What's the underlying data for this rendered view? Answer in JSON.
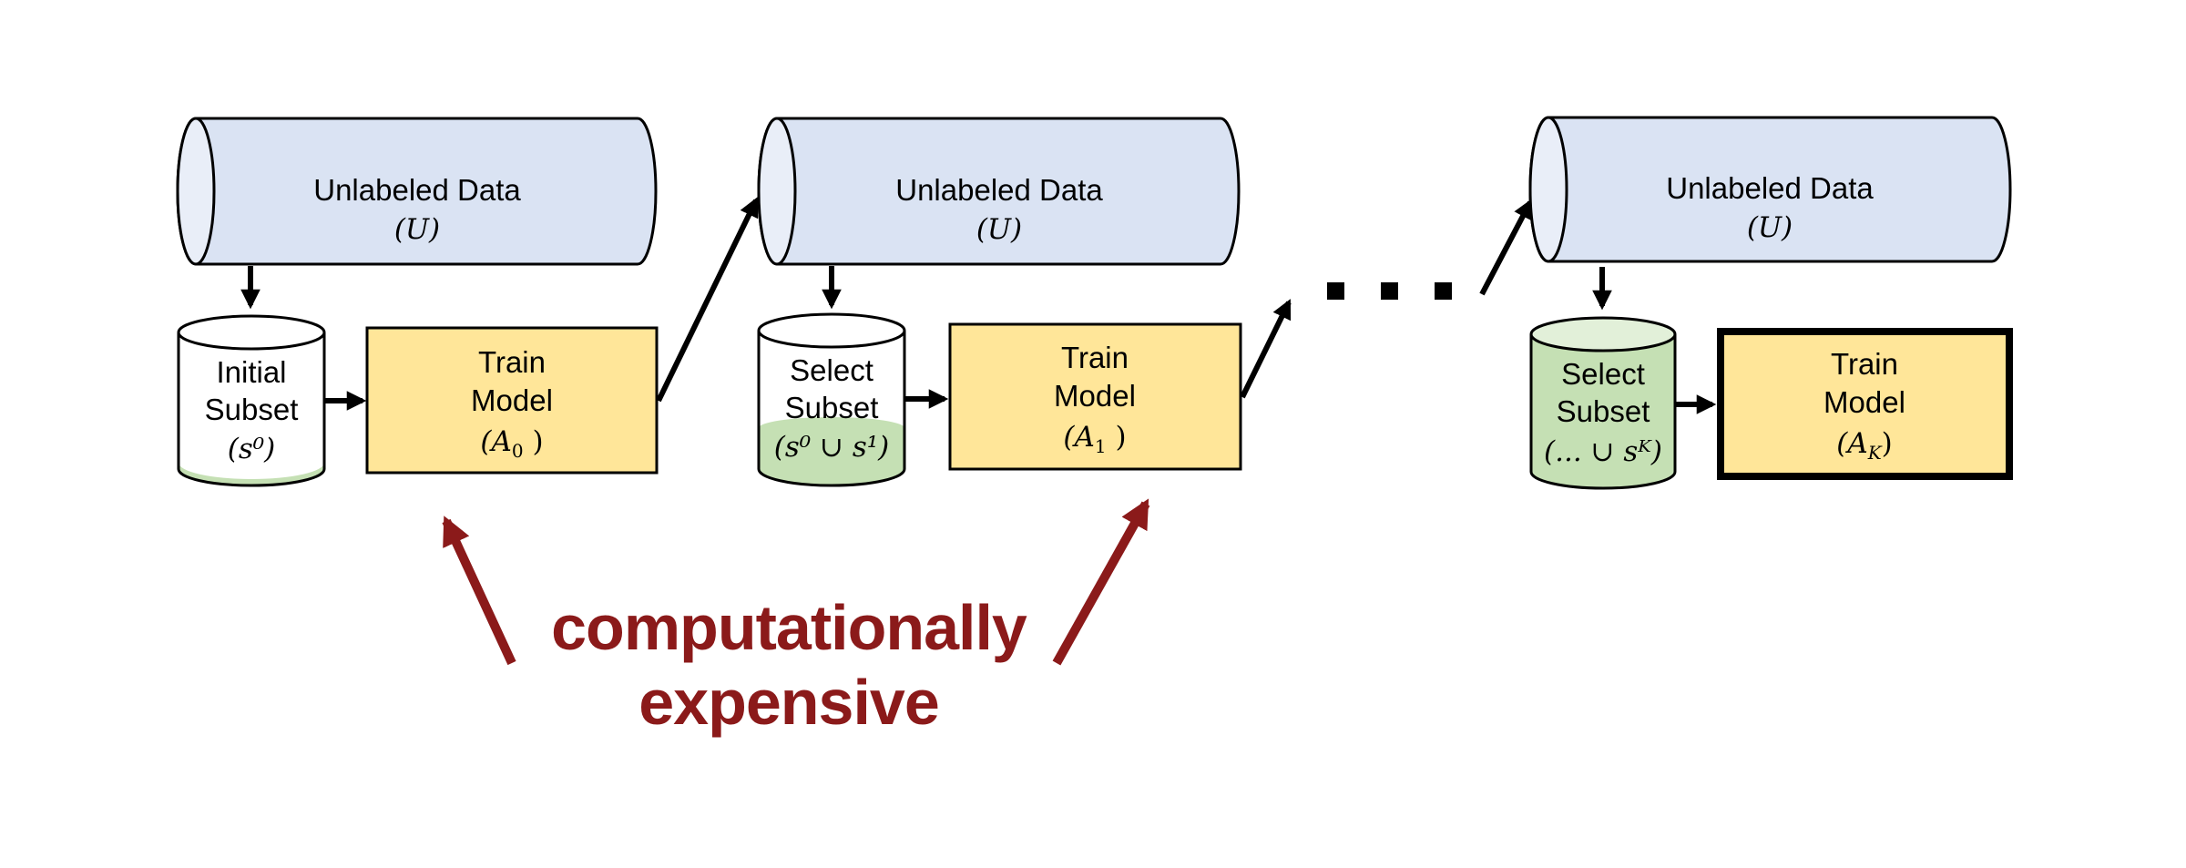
{
  "diagram": {
    "stages": [
      {
        "pool": {
          "label": "Unlabeled Data",
          "symbol": "(U)"
        },
        "subset": {
          "line1": "Initial",
          "line2": "Subset",
          "formula": "(s⁰)",
          "fill_level": 0.05
        },
        "model": {
          "line1": "Train",
          "line2": "Model",
          "formula_base": "(A",
          "formula_sub": "0",
          "formula_end": " )",
          "highlighted": false
        }
      },
      {
        "pool": {
          "label": "Unlabeled Data",
          "symbol": "(U)"
        },
        "subset": {
          "line1": "Select",
          "line2": "Subset",
          "formula": "(s⁰ ∪ s¹)",
          "fill_level": 0.35
        },
        "model": {
          "line1": "Train",
          "line2": "Model",
          "formula_base": "(A",
          "formula_sub": "1",
          "formula_end": " )",
          "highlighted": false
        }
      },
      {
        "pool": {
          "label": "Unlabeled Data",
          "symbol": "(U)"
        },
        "subset": {
          "line1": "Select",
          "line2": "Subset",
          "formula": "(... ∪ sᴷ)",
          "fill_level": 1.0
        },
        "model": {
          "line1": "Train",
          "line2": "Model",
          "formula_base": "(A",
          "formula_sub": "K",
          "formula_end": ")",
          "highlighted": true
        }
      }
    ],
    "ellipsis": "...",
    "annotation": {
      "line1": "computationally",
      "line2": "expensive"
    },
    "colors": {
      "pool_fill": "#dae3f3",
      "pool_cap": "#e9eef8",
      "model_fill": "#ffe699",
      "subset_fill": "#c5e0b4",
      "subset_cap_full": "#e2f0d9",
      "annotation": "#8b1a1a",
      "stroke": "#000000"
    }
  }
}
